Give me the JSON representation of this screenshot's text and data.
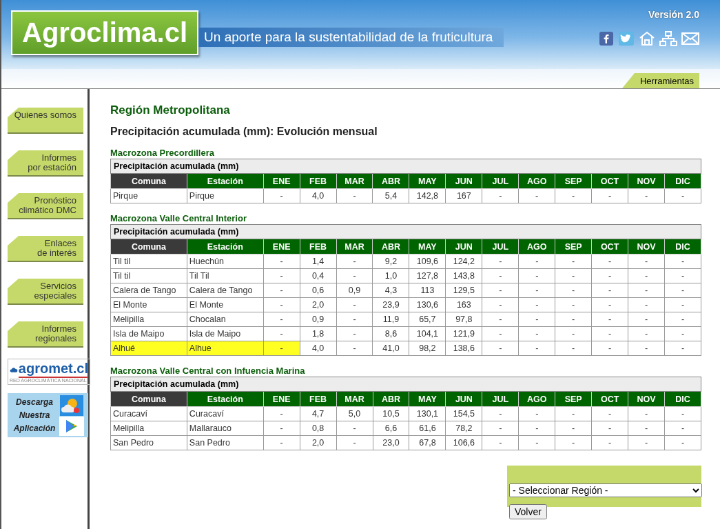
{
  "header": {
    "logo": "Agroclima.cl",
    "tagline": "Un aporte para la sustentabilidad de la fruticultura",
    "version": "Versión 2.0",
    "tools_tab": "Herramientas"
  },
  "sidebar": {
    "items": [
      {
        "label": "Quienes somos"
      },
      {
        "label": "Informes por estación"
      },
      {
        "label": "Pronóstico climático DMC"
      },
      {
        "label": "Enlaces de interés"
      },
      {
        "label": "Servicios especiales"
      },
      {
        "label": "Informes regionales"
      }
    ],
    "agromet": {
      "name": "agromet.cl",
      "subtitle": "RED AGROCLIMÁTICA NACIONAL"
    },
    "app_promo": {
      "text": "Descarga Nuestra Aplicación"
    }
  },
  "content": {
    "title": "Región Metropolitana",
    "subtitle": "Precipitación acumulada (mm): Evolución mensual",
    "sections": [
      {
        "title": "Macrozona Precordillera",
        "caption": "Precipitación acumulada (mm)",
        "columns": [
          "Comuna",
          "Estación",
          "ENE",
          "FEB",
          "MAR",
          "ABR",
          "MAY",
          "JUN",
          "JUL",
          "AGO",
          "SEP",
          "OCT",
          "NOV",
          "DIC"
        ],
        "rows": [
          {
            "highlighted": false,
            "cells": [
              "Pirque",
              "Pirque",
              "-",
              "4,0",
              "-",
              "5,4",
              "142,8",
              "167",
              "-",
              "-",
              "-",
              "-",
              "-",
              "-"
            ]
          }
        ]
      },
      {
        "title": "Macrozona Valle Central Interior",
        "caption": "Precipitación acumulada (mm)",
        "columns": [
          "Comuna",
          "Estación",
          "ENE",
          "FEB",
          "MAR",
          "ABR",
          "MAY",
          "JUN",
          "JUL",
          "AGO",
          "SEP",
          "OCT",
          "NOV",
          "DIC"
        ],
        "rows": [
          {
            "highlighted": false,
            "cells": [
              "Til til",
              "Huechún",
              "-",
              "1,4",
              "-",
              "9,2",
              "109,6",
              "124,2",
              "-",
              "-",
              "-",
              "-",
              "-",
              "-"
            ]
          },
          {
            "highlighted": false,
            "cells": [
              "Til til",
              "Til Til",
              "-",
              "0,4",
              "-",
              "1,0",
              "127,8",
              "143,8",
              "-",
              "-",
              "-",
              "-",
              "-",
              "-"
            ]
          },
          {
            "highlighted": false,
            "cells": [
              "Calera de Tango",
              "Calera de Tango",
              "-",
              "0,6",
              "0,9",
              "4,3",
              "113",
              "129,5",
              "-",
              "-",
              "-",
              "-",
              "-",
              "-"
            ]
          },
          {
            "highlighted": false,
            "cells": [
              "El Monte",
              "El Monte",
              "-",
              "2,0",
              "-",
              "23,9",
              "130,6",
              "163",
              "-",
              "-",
              "-",
              "-",
              "-",
              "-"
            ]
          },
          {
            "highlighted": false,
            "cells": [
              "Melipilla",
              "Chocalan",
              "-",
              "0,9",
              "-",
              "11,9",
              "65,7",
              "97,8",
              "-",
              "-",
              "-",
              "-",
              "-",
              "-"
            ]
          },
          {
            "highlighted": false,
            "cells": [
              "Isla de Maipo",
              "Isla de Maipo",
              "-",
              "1,8",
              "-",
              "8,6",
              "104,1",
              "121,9",
              "-",
              "-",
              "-",
              "-",
              "-",
              "-"
            ]
          },
          {
            "highlighted": true,
            "cells": [
              "Alhué",
              "Alhue",
              "-",
              "4,0",
              "-",
              "41,0",
              "98,2",
              "138,6",
              "-",
              "-",
              "-",
              "-",
              "-",
              "-"
            ]
          }
        ]
      },
      {
        "title": "Macrozona Valle Central con Infuencia Marina",
        "caption": "Precipitación acumulada (mm)",
        "columns": [
          "Comuna",
          "Estación",
          "ENE",
          "FEB",
          "MAR",
          "ABR",
          "MAY",
          "JUN",
          "JUL",
          "AGO",
          "SEP",
          "OCT",
          "NOV",
          "DIC"
        ],
        "rows": [
          {
            "highlighted": false,
            "cells": [
              "Curacaví",
              "Curacaví",
              "-",
              "4,7",
              "5,0",
              "10,5",
              "130,1",
              "154,5",
              "-",
              "-",
              "-",
              "-",
              "-",
              "-"
            ]
          },
          {
            "highlighted": false,
            "cells": [
              "Melipilla",
              "Mallarauco",
              "-",
              "0,8",
              "-",
              "6,6",
              "61,6",
              "78,2",
              "-",
              "-",
              "-",
              "-",
              "-",
              "-"
            ]
          },
          {
            "highlighted": false,
            "cells": [
              "San Pedro",
              "San Pedro",
              "-",
              "2,0",
              "-",
              "23,0",
              "67,8",
              "106,6",
              "-",
              "-",
              "-",
              "-",
              "-",
              "-"
            ]
          }
        ]
      }
    ]
  },
  "region_form": {
    "select_placeholder": "- Seleccionar Región -",
    "button": "Volver"
  }
}
